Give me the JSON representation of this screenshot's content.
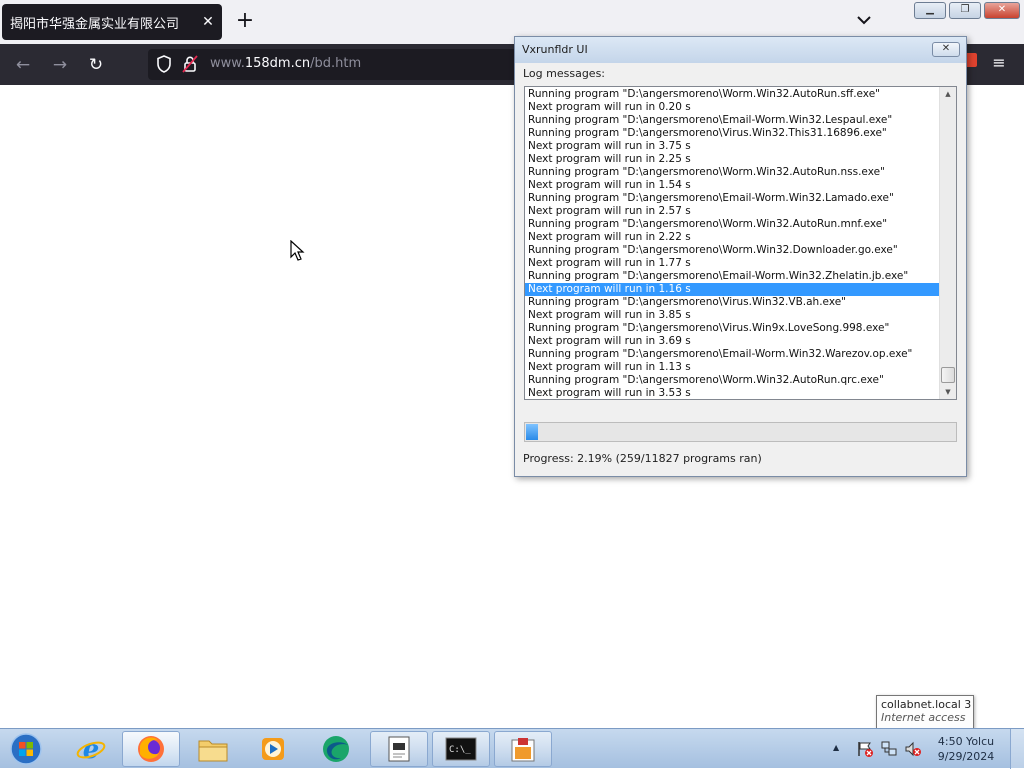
{
  "browser": {
    "tab_title": "揭阳市华强金属实业有限公司",
    "tab_close": "✕",
    "new_tab": "+",
    "tabs_list": "⌄",
    "url_prefix": "www.",
    "url_domain": "158dm.cn",
    "url_path": "/bd.htm",
    "window_controls": {
      "minimize": "▁",
      "restore": "❐",
      "close": "✕"
    },
    "nav": {
      "back": "←",
      "forward": "→",
      "reload": "↻",
      "menu": "≡"
    }
  },
  "dialog": {
    "title": "Vxrunfldr UI",
    "close": "✕",
    "log_label": "Log messages:",
    "log_lines": [
      "Running program \"D:\\angersmoreno\\Worm.Win32.AutoRun.sff.exe\"",
      "Next program will run in 0.20 s",
      "Running program \"D:\\angersmoreno\\Email-Worm.Win32.Lespaul.exe\"",
      "Running program \"D:\\angersmoreno\\Virus.Win32.This31.16896.exe\"",
      "Next program will run in 3.75 s",
      "Next program will run in 2.25 s",
      "Running program \"D:\\angersmoreno\\Worm.Win32.AutoRun.nss.exe\"",
      "Next program will run in 1.54 s",
      "Running program \"D:\\angersmoreno\\Email-Worm.Win32.Lamado.exe\"",
      "Next program will run in 2.57 s",
      "Running program \"D:\\angersmoreno\\Worm.Win32.AutoRun.mnf.exe\"",
      "Next program will run in 2.22 s",
      "Running program \"D:\\angersmoreno\\Worm.Win32.Downloader.go.exe\"",
      "Next program will run in 1.77 s",
      "Running program \"D:\\angersmoreno\\Email-Worm.Win32.Zhelatin.jb.exe\"",
      "Next program will run in 1.16 s",
      "Running program \"D:\\angersmoreno\\Virus.Win32.VB.ah.exe\"",
      "Next program will run in 3.85 s",
      "Running program \"D:\\angersmoreno\\Virus.Win9x.LoveSong.998.exe\"",
      "Next program will run in 3.69 s",
      "Running program \"D:\\angersmoreno\\Email-Worm.Win32.Warezov.op.exe\"",
      "Next program will run in 1.13 s",
      "Running program \"D:\\angersmoreno\\Worm.Win32.AutoRun.qrc.exe\"",
      "Next program will run in 3.53 s"
    ],
    "selected_index": 15,
    "progress_fraction": 0.0219,
    "progress_text": "Progress: 2.19% (259/11827 programs ran)"
  },
  "tooltip": {
    "network": "collabnet.local  3",
    "status": "Internet access"
  },
  "taskbar": {
    "apps": [
      "internet-explorer",
      "firefox",
      "file-explorer",
      "media-player",
      "browser-app",
      "notepad",
      "command-prompt",
      "paint"
    ],
    "clock_time": "4:50 Yolcu",
    "clock_date": "9/29/2024"
  },
  "colors": {
    "selection": "#3399ff",
    "tab_dark": "#1c1b22",
    "nav_dark": "#2b2a33",
    "taskbar": "#b8cee8"
  }
}
